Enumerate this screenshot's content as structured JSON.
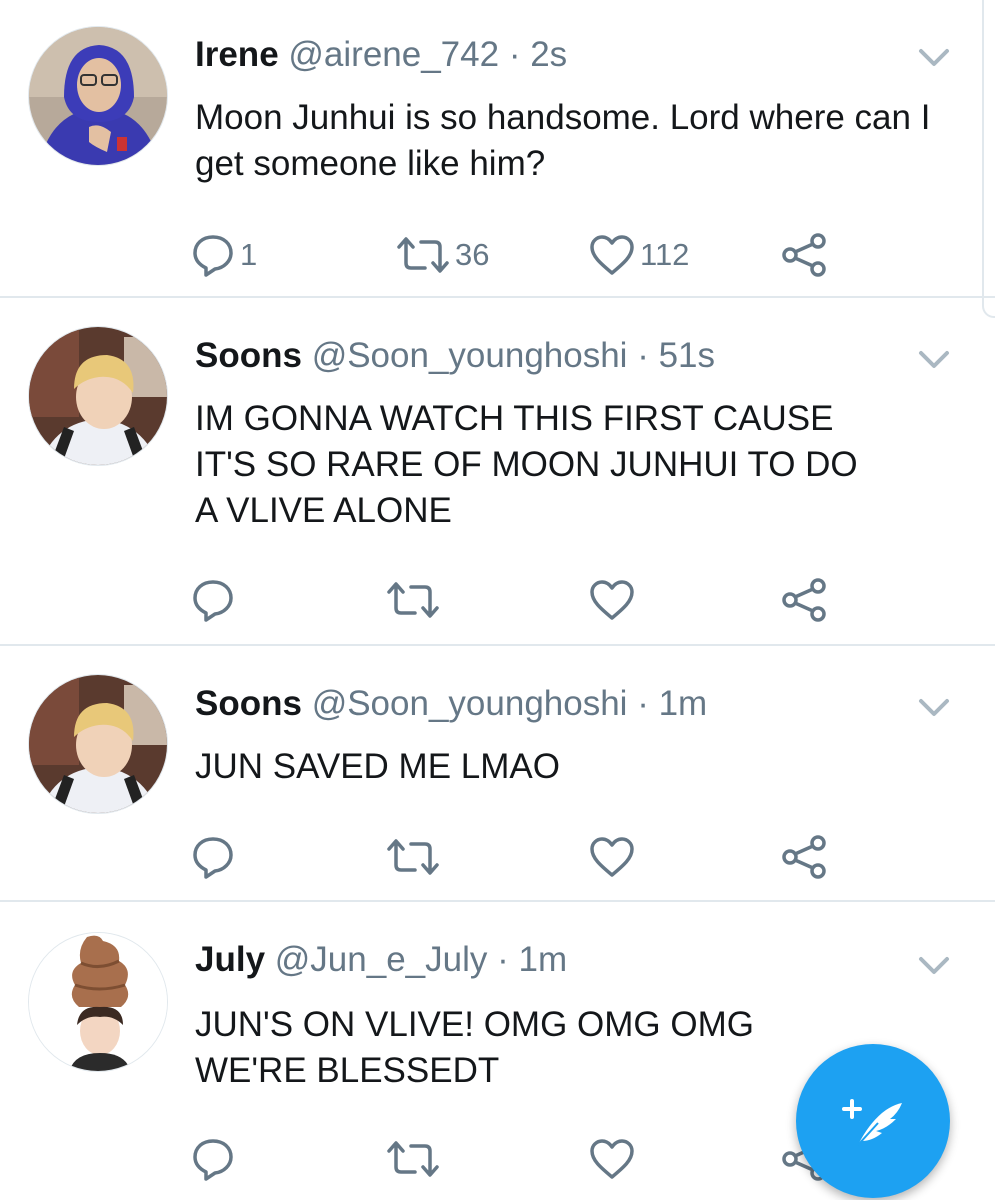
{
  "tweets": [
    {
      "name": "Irene",
      "handle": "@airene_742",
      "separator": "·",
      "time": "2s",
      "text": "Moon Junhui is so handsome. Lord where can I get someone like him?",
      "replies": "1",
      "retweets": "36",
      "likes": "112"
    },
    {
      "name": "Soons",
      "handle": "@Soon_younghoshi",
      "separator": "·",
      "time": "51s",
      "text": "IM GONNA WATCH THIS FIRST CAUSE IT'S SO RARE OF MOON JUNHUI TO DO A VLIVE ALONE",
      "replies": "",
      "retweets": "",
      "likes": ""
    },
    {
      "name": "Soons",
      "handle": "@Soon_younghoshi",
      "separator": "·",
      "time": "1m",
      "text": "JUN SAVED ME LMAO",
      "replies": "",
      "retweets": "",
      "likes": ""
    },
    {
      "name": "July",
      "handle": "@Jun_e_July",
      "separator": "·",
      "time": "1m",
      "text": "JUN'S ON VLIVE! OMG OMG OMG WE'RE BLESSEDT",
      "replies": "",
      "retweets": "",
      "likes": ""
    }
  ],
  "icons": {
    "reply": "reply-icon",
    "retweet": "retweet-icon",
    "like": "heart-icon",
    "share": "share-icon",
    "caret": "chevron-down-icon",
    "compose": "compose-tweet-icon"
  },
  "colors": {
    "accent": "#1da1f2",
    "icon_gray": "#657786",
    "divider": "#e1e8ed"
  }
}
